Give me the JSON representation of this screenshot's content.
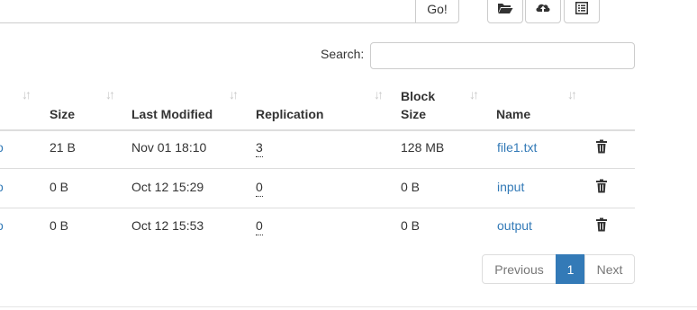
{
  "toolbar": {
    "path_value": "",
    "go_label": "Go!",
    "icons": [
      "folder-open-icon",
      "cloud-upload-icon",
      "list-alt-icon"
    ]
  },
  "search": {
    "label": "Search:",
    "value": ""
  },
  "table": {
    "headers": {
      "size": "Size",
      "last_modified": "Last Modified",
      "replication": "Replication",
      "block_size_line1": "Block",
      "block_size_line2": "Size",
      "name": "Name"
    },
    "rows": [
      {
        "size": "21 B",
        "last_modified": "Nov 01 18:10",
        "replication": "3",
        "block_size": "128 MB",
        "name": "file1.txt"
      },
      {
        "size": "0 B",
        "last_modified": "Oct 12 15:29",
        "replication": "0",
        "block_size": "0 B",
        "name": "input"
      },
      {
        "size": "0 B",
        "last_modified": "Oct 12 15:53",
        "replication": "0",
        "block_size": "0 B",
        "name": "output"
      }
    ]
  },
  "pagination": {
    "previous": "Previous",
    "current": "1",
    "next": "Next"
  },
  "colors": {
    "link": "#337ab7",
    "active_page": "#337ab7",
    "border": "#dddddd"
  }
}
